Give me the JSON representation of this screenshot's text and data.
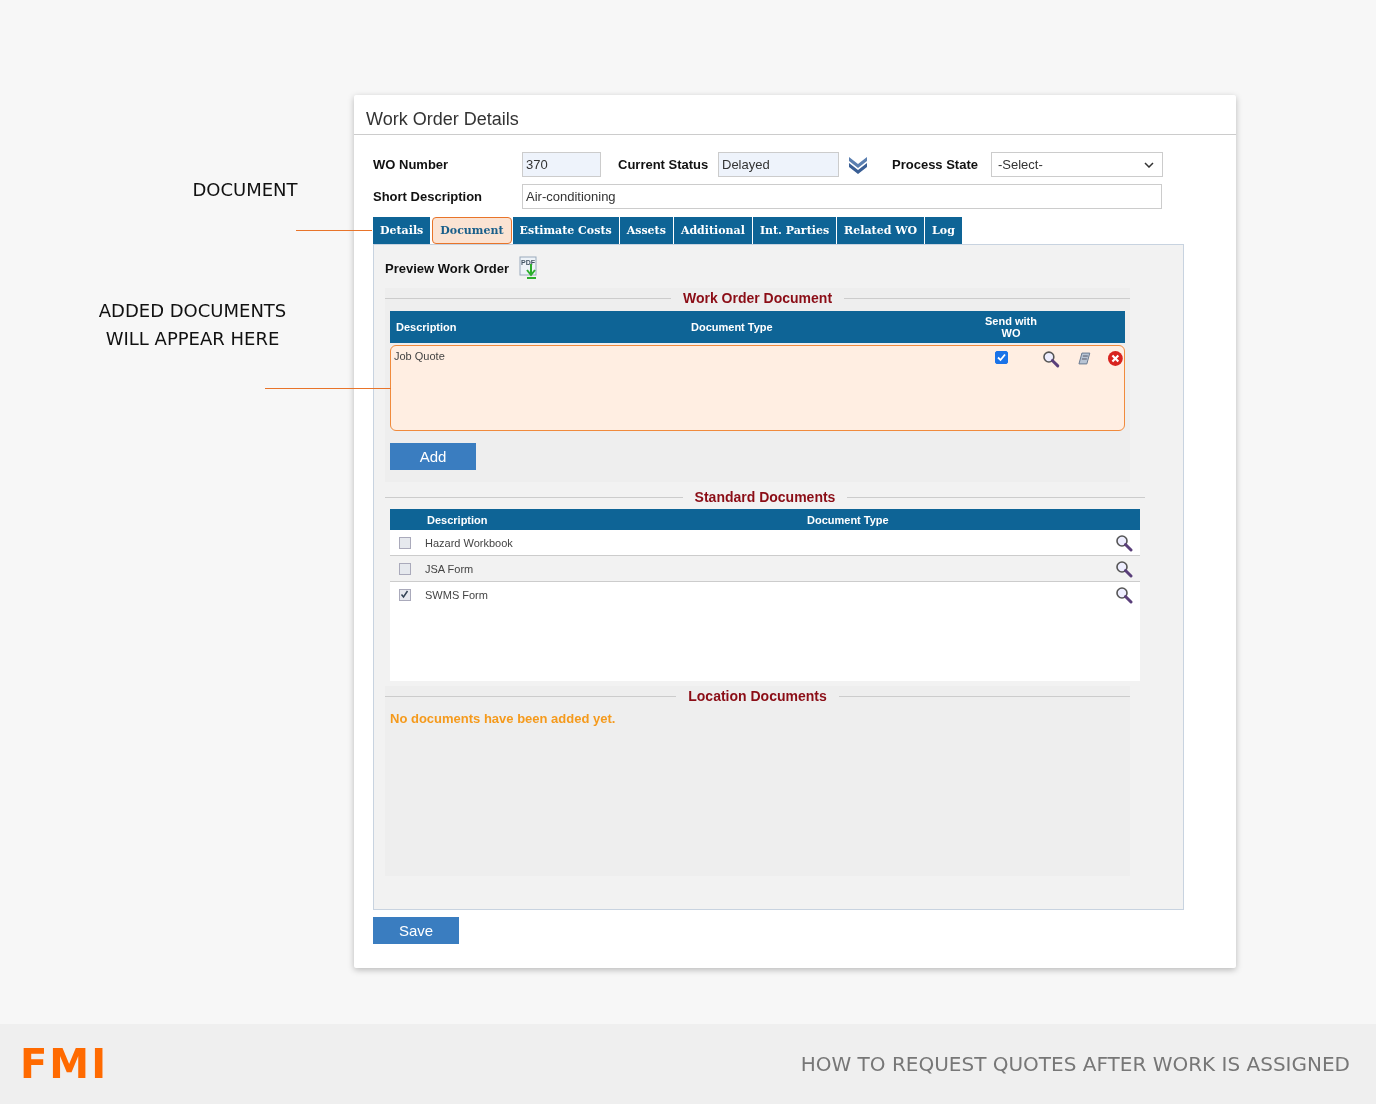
{
  "annotations": [
    {
      "text": "DOCUMENT"
    },
    {
      "text": "ADDED DOCUMENTS WILL APPEAR HERE"
    }
  ],
  "window": {
    "title": "Work Order Details"
  },
  "form": {
    "wo_number": {
      "label": "WO Number",
      "value": "370"
    },
    "current_status": {
      "label": "Current Status",
      "value": "Delayed"
    },
    "process_state": {
      "label": "Process State",
      "value": "-Select-"
    },
    "short_description": {
      "label": "Short Description",
      "value": "Air-conditioning"
    }
  },
  "tabs": [
    {
      "label": "Details",
      "selected": false
    },
    {
      "label": "Document",
      "selected": true
    },
    {
      "label": "Estimate Costs",
      "selected": false
    },
    {
      "label": "Assets",
      "selected": false
    },
    {
      "label": "Additional",
      "selected": false
    },
    {
      "label": "Int. Parties",
      "selected": false
    },
    {
      "label": "Related WO",
      "selected": false
    },
    {
      "label": "Log",
      "selected": false
    }
  ],
  "preview": {
    "label": "Preview Work Order",
    "icon_text": "PDF"
  },
  "work_order_document": {
    "title": "Work Order Document",
    "columns": [
      "Description",
      "Document Type",
      "Send with WO"
    ],
    "rows": [
      {
        "description": "Job Quote",
        "send_with_wo": true
      }
    ],
    "add_button": "Add"
  },
  "standard_documents": {
    "title": "Standard Documents",
    "columns": [
      "Description",
      "Document Type"
    ],
    "rows": [
      {
        "description": "Hazard Workbook",
        "checked": false
      },
      {
        "description": "JSA Form",
        "checked": false
      },
      {
        "description": "SWMS Form",
        "checked": true
      }
    ]
  },
  "location_documents": {
    "title": "Location Documents",
    "message": "No documents have been added yet."
  },
  "save_button": "Save",
  "footer": {
    "logo": "FMI",
    "caption": "HOW TO REQUEST QUOTES AFTER WORK IS ASSIGNED"
  }
}
